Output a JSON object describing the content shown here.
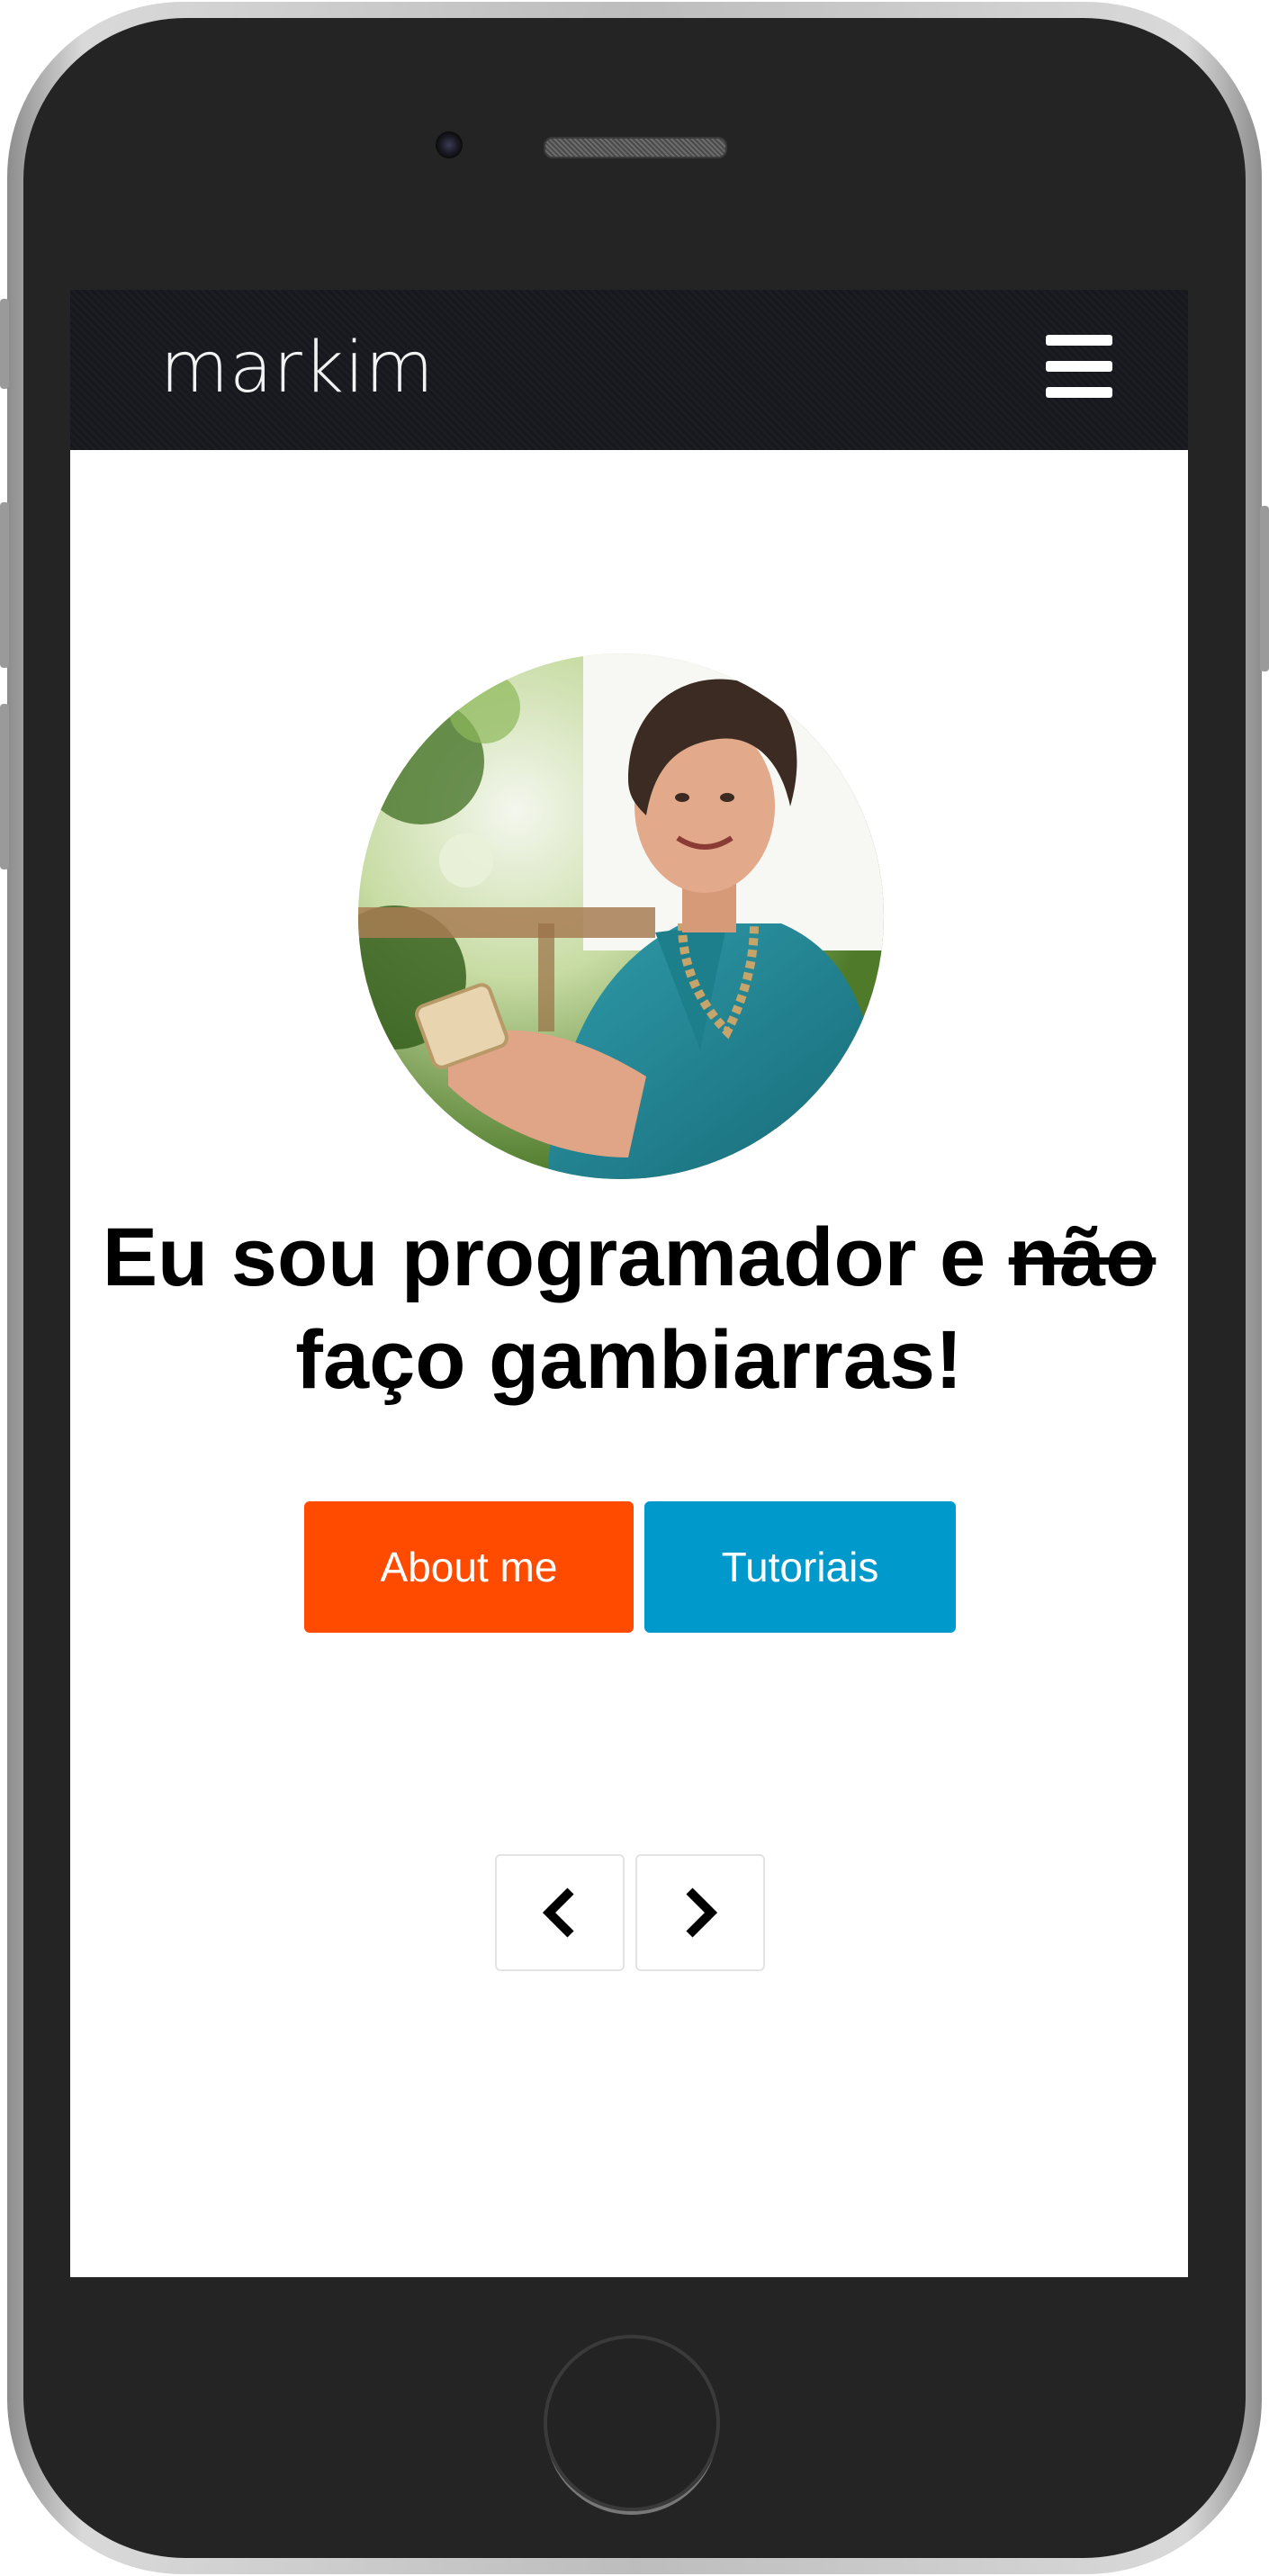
{
  "navbar": {
    "brand": "markim",
    "menu_icon": "hamburger-icon"
  },
  "hero": {
    "headline_part1": "Eu sou programador e ",
    "headline_strike": "não",
    "headline_part2": "faço gambiarras!",
    "buttons": [
      {
        "label": "About me",
        "color": "#ff4b00"
      },
      {
        "label": "Tutoriais",
        "color": "#0099cc"
      }
    ]
  },
  "carousel": {
    "prev_icon": "chevron-left-icon",
    "next_icon": "chevron-right-icon"
  },
  "colors": {
    "navbar_bg": "#16181d",
    "accent_orange": "#ff4b00",
    "accent_blue": "#0099cc"
  }
}
